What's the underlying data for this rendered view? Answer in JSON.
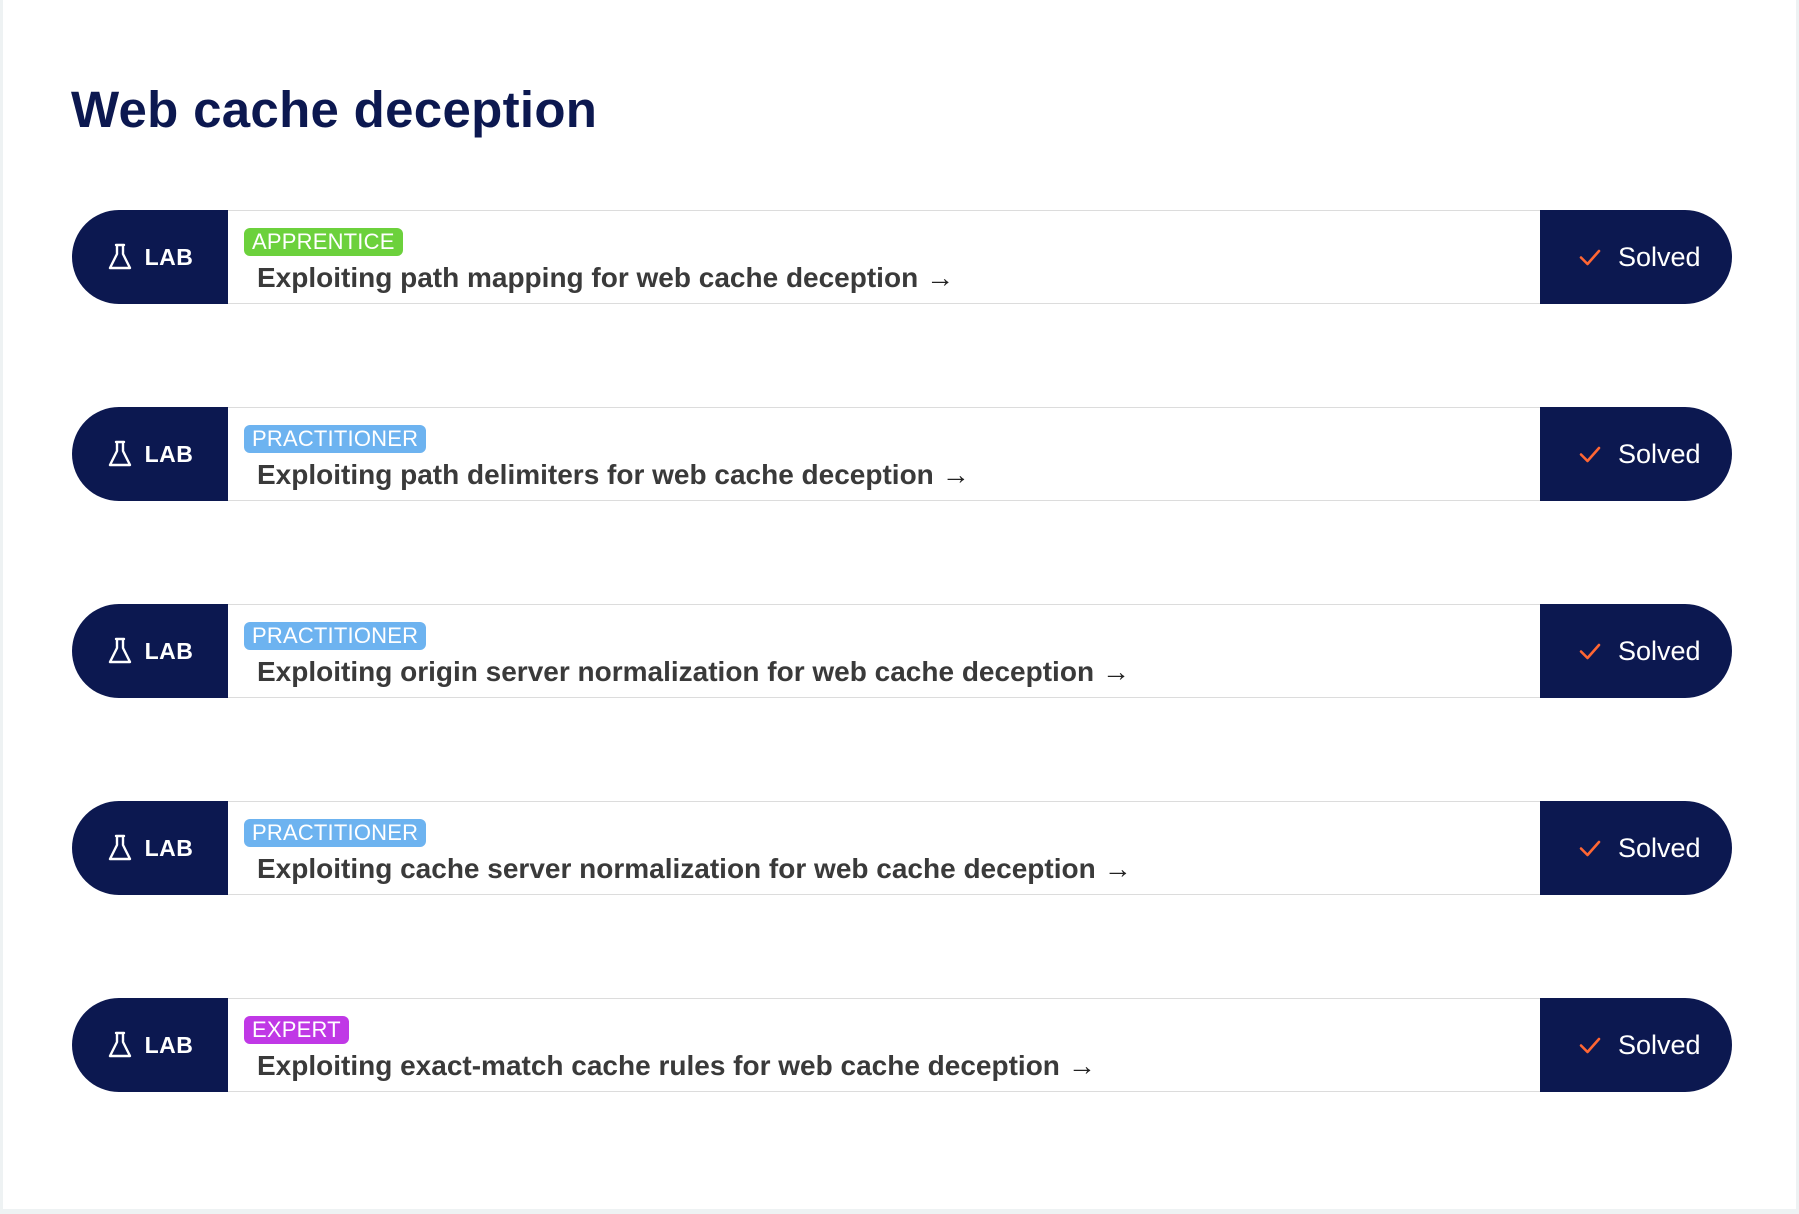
{
  "page": {
    "title": "Web cache deception"
  },
  "colors": {
    "navy": "#0c1850",
    "apprentice": "#6cd13c",
    "practitioner": "#6db3f0",
    "expert": "#c038e6",
    "check": "#ff6633"
  },
  "labs": [
    {
      "type_label": "LAB",
      "type_icon": "flask-icon",
      "level": "APPRENTICE",
      "title": "Exploiting path mapping for web cache deception",
      "arrow_icon": "arrow-right-icon",
      "status": "Solved",
      "status_icon": "check-icon"
    },
    {
      "type_label": "LAB",
      "type_icon": "flask-icon",
      "level": "PRACTITIONER",
      "title": "Exploiting path delimiters for web cache deception",
      "arrow_icon": "arrow-right-icon",
      "status": "Solved",
      "status_icon": "check-icon"
    },
    {
      "type_label": "LAB",
      "type_icon": "flask-icon",
      "level": "PRACTITIONER",
      "title": "Exploiting origin server normalization for web cache deception",
      "arrow_icon": "arrow-right-icon",
      "status": "Solved",
      "status_icon": "check-icon"
    },
    {
      "type_label": "LAB",
      "type_icon": "flask-icon",
      "level": "PRACTITIONER",
      "title": "Exploiting cache server normalization for web cache deception",
      "arrow_icon": "arrow-right-icon",
      "status": "Solved",
      "status_icon": "check-icon"
    },
    {
      "type_label": "LAB",
      "type_icon": "flask-icon",
      "level": "EXPERT",
      "title": "Exploiting exact-match cache rules for web cache deception",
      "arrow_icon": "arrow-right-icon",
      "status": "Solved",
      "status_icon": "check-icon"
    }
  ]
}
